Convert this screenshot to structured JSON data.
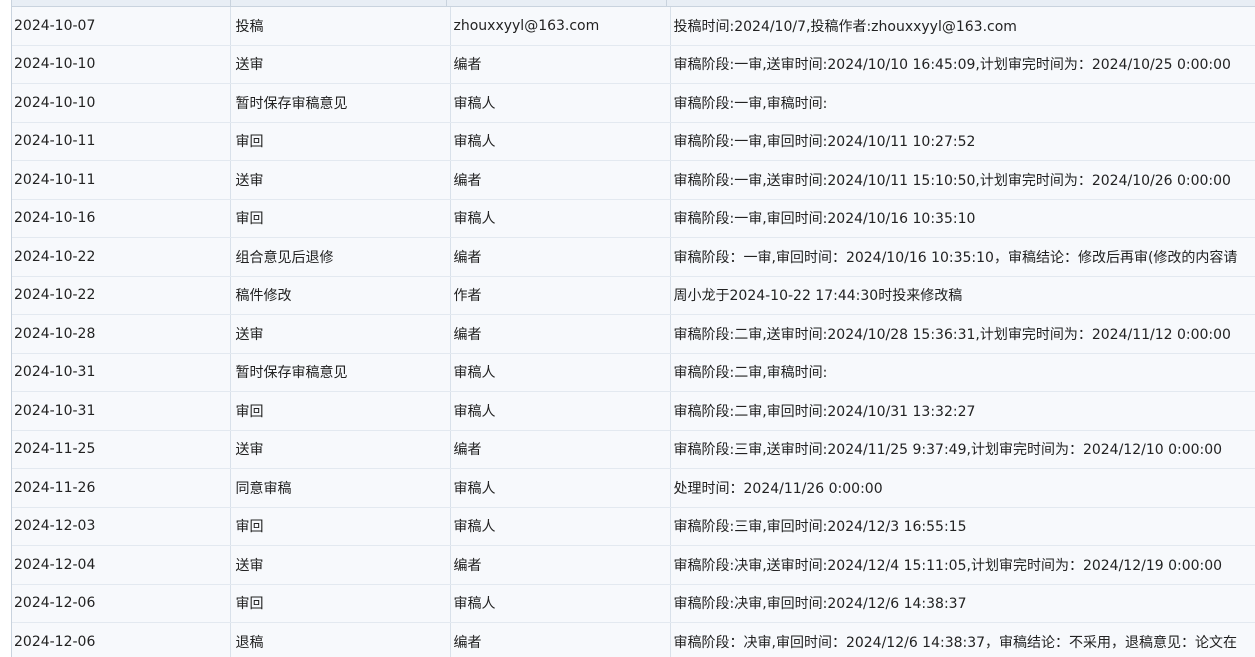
{
  "rows": [
    {
      "date": "2024-10-07",
      "action": "投稿",
      "user": "zhouxxyyl@163.com",
      "detail": "投稿时间:2024/10/7,投稿作者:zhouxxyyl@163.com"
    },
    {
      "date": "2024-10-10",
      "action": "送审",
      "user": "编者",
      "detail": "审稿阶段:一审,送审时间:2024/10/10 16:45:09,计划审完时间为：2024/10/25 0:00:00"
    },
    {
      "date": "2024-10-10",
      "action": "暂时保存审稿意见",
      "user": "审稿人",
      "detail": "审稿阶段:一审,审稿时间:"
    },
    {
      "date": "2024-10-11",
      "action": "审回",
      "user": "审稿人",
      "detail": "审稿阶段:一审,审回时间:2024/10/11 10:27:52"
    },
    {
      "date": "2024-10-11",
      "action": "送审",
      "user": "编者",
      "detail": "审稿阶段:一审,送审时间:2024/10/11 15:10:50,计划审完时间为：2024/10/26 0:00:00"
    },
    {
      "date": "2024-10-16",
      "action": "审回",
      "user": "审稿人",
      "detail": "审稿阶段:一审,审回时间:2024/10/16 10:35:10"
    },
    {
      "date": "2024-10-22",
      "action": "组合意见后退修",
      "user": "编者",
      "detail": "审稿阶段：一审,审回时间：2024/10/16 10:35:10，审稿结论：修改后再审(修改的内容请"
    },
    {
      "date": "2024-10-22",
      "action": "稿件修改",
      "user": "作者",
      "detail": "周小龙于2024-10-22 17:44:30时投来修改稿"
    },
    {
      "date": "2024-10-28",
      "action": "送审",
      "user": "编者",
      "detail": "审稿阶段:二审,送审时间:2024/10/28 15:36:31,计划审完时间为：2024/11/12 0:00:00"
    },
    {
      "date": "2024-10-31",
      "action": "暂时保存审稿意见",
      "user": "审稿人",
      "detail": "审稿阶段:二审,审稿时间:"
    },
    {
      "date": "2024-10-31",
      "action": "审回",
      "user": "审稿人",
      "detail": "审稿阶段:二审,审回时间:2024/10/31 13:32:27"
    },
    {
      "date": "2024-11-25",
      "action": "送审",
      "user": "编者",
      "detail": "审稿阶段:三审,送审时间:2024/11/25 9:37:49,计划审完时间为：2024/12/10 0:00:00"
    },
    {
      "date": "2024-11-26",
      "action": "同意审稿",
      "user": "审稿人",
      "detail": "处理时间：2024/11/26 0:00:00"
    },
    {
      "date": "2024-12-03",
      "action": "审回",
      "user": "审稿人",
      "detail": "审稿阶段:三审,审回时间:2024/12/3 16:55:15"
    },
    {
      "date": "2024-12-04",
      "action": "送审",
      "user": "编者",
      "detail": "审稿阶段:决审,送审时间:2024/12/4 15:11:05,计划审完时间为：2024/12/19 0:00:00"
    },
    {
      "date": "2024-12-06",
      "action": "审回",
      "user": "审稿人",
      "detail": "审稿阶段:决审,审回时间:2024/12/6 14:38:37"
    },
    {
      "date": "2024-12-06",
      "action": "退稿",
      "user": "编者",
      "detail": "审稿阶段：决审,审回时间：2024/12/6 14:38:37，审稿结论：不采用，退稿意见：论文在"
    }
  ]
}
